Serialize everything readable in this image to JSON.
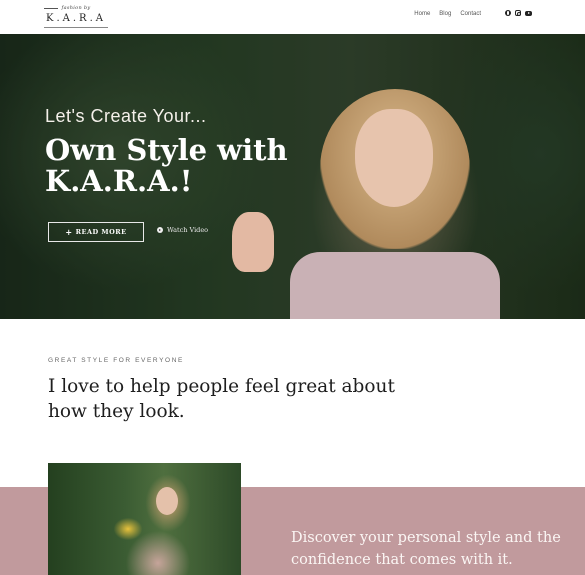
{
  "header": {
    "logo": {
      "tagline": "fashion by",
      "name": "K.A.R.A"
    },
    "nav": [
      "Home",
      "Blog",
      "Contact"
    ],
    "social_icons": [
      "pinterest-icon",
      "instagram-icon",
      "youtube-icon"
    ]
  },
  "hero": {
    "kicker": "Let's Create Your...",
    "title_line1": "Own Style with",
    "title_line2": "K.A.R.A.!",
    "read_more": "READ MORE",
    "watch_video": "Watch Video"
  },
  "intro": {
    "eyebrow": "GREAT STYLE FOR EVERYONE",
    "heading": "I love to help people feel great about how they look."
  },
  "band": {
    "text": "Discover your personal style and the confidence that comes with it."
  },
  "colors": {
    "band": "#c19a9d",
    "hero_overlay": "#24391f"
  }
}
